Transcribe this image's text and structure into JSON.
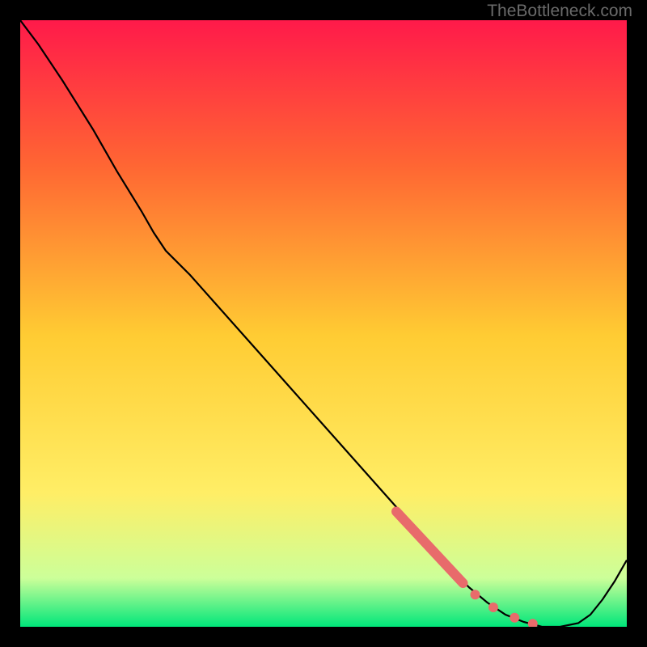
{
  "watermark": "TheBottleneck.com",
  "chart_data": {
    "type": "line",
    "title": "",
    "xlabel": "",
    "ylabel": "",
    "xlim": [
      0,
      100
    ],
    "ylim": [
      0,
      100
    ],
    "gradient_colors": {
      "top": "#ff1a4a",
      "mid_upper": "#ff6633",
      "mid": "#ffcc33",
      "mid_lower": "#ffee66",
      "lower": "#ccff99",
      "bottom": "#00e67a"
    },
    "series": [
      {
        "name": "bottleneck-curve",
        "type": "line",
        "color": "#000000",
        "x": [
          0,
          3,
          7,
          12,
          16,
          20,
          22,
          24,
          28,
          32,
          36,
          40,
          44,
          48,
          52,
          56,
          60,
          64,
          68,
          71,
          74,
          77,
          80,
          83,
          86,
          89,
          92,
          94,
          96,
          98,
          100
        ],
        "y": [
          100,
          96,
          90,
          82,
          75,
          68.5,
          65,
          62,
          58,
          53.5,
          49,
          44.5,
          40,
          35.5,
          31,
          26.5,
          22,
          17.5,
          13,
          9.5,
          6.5,
          4,
          2,
          0.8,
          0,
          0,
          0.6,
          2,
          4.5,
          7.5,
          11
        ]
      },
      {
        "name": "highlight-thick",
        "type": "line-segment",
        "color": "#e86b6b",
        "stroke_width": 12,
        "x": [
          62,
          73
        ],
        "y": [
          19,
          7.2
        ]
      },
      {
        "name": "highlight-dots",
        "type": "scatter",
        "color": "#e86b6b",
        "radius": 6,
        "x": [
          75,
          78,
          81.5,
          84.5
        ],
        "y": [
          5.3,
          3.2,
          1.5,
          0.5
        ]
      }
    ]
  }
}
